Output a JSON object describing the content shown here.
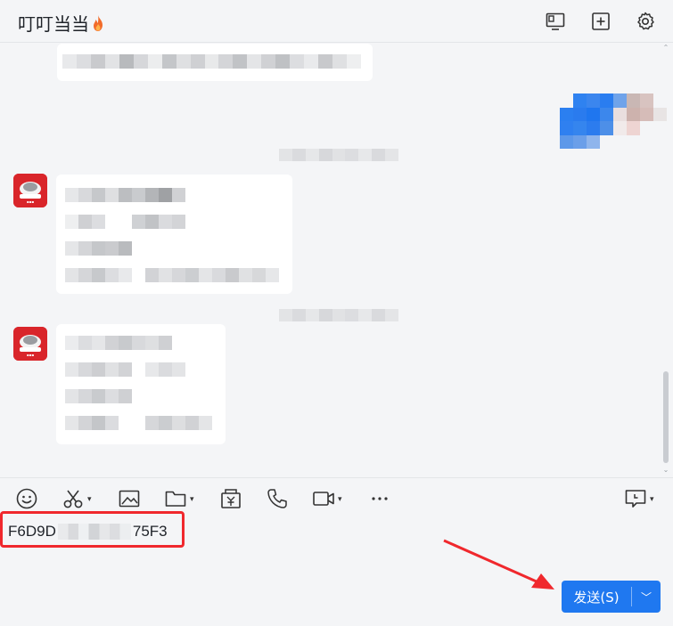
{
  "header": {
    "title": "叮叮当当",
    "icons": [
      "screen-share-icon",
      "add-box-icon",
      "settings-gear-icon"
    ]
  },
  "toolbar": {
    "tools": [
      "emoji-icon",
      "scissors-icon",
      "image-icon",
      "folder-icon",
      "red-packet-icon",
      "phone-icon",
      "video-icon",
      "more-icon",
      "message-menu-icon"
    ]
  },
  "input": {
    "text_prefix": "F6D9D",
    "text_suffix": "75F3"
  },
  "send_button": {
    "label": "发送(S)"
  },
  "colors": {
    "accent": "#1f78f0",
    "highlight": "#f0282d",
    "avatar_red": "#d9252a"
  }
}
